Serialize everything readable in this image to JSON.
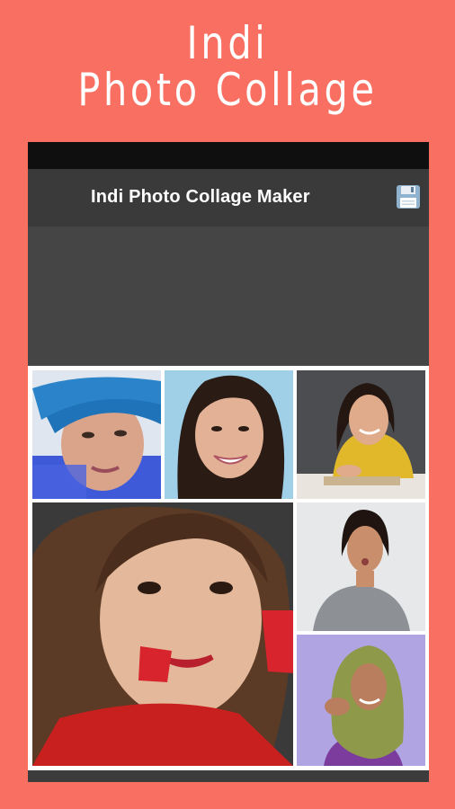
{
  "promo": {
    "title_line1": "Indi",
    "title_line2": "Photo Collage"
  },
  "app_bar": {
    "title": "Indi Photo Collage Maker",
    "save_icon": "floppy-disk-icon"
  },
  "colors": {
    "background": "#F96F61",
    "app_bar": "#3a3a3a",
    "status_bar": "#0f0f0f",
    "collage_border": "#ffffff"
  },
  "collage": {
    "photos": [
      {
        "name": "photo-woman-blue-turban"
      },
      {
        "name": "photo-woman-smiling-long-hair"
      },
      {
        "name": "photo-woman-yellow-shirt-book"
      },
      {
        "name": "photo-woman-red-earrings"
      },
      {
        "name": "photo-woman-grey-top"
      },
      {
        "name": "photo-woman-green-scarf"
      }
    ]
  }
}
